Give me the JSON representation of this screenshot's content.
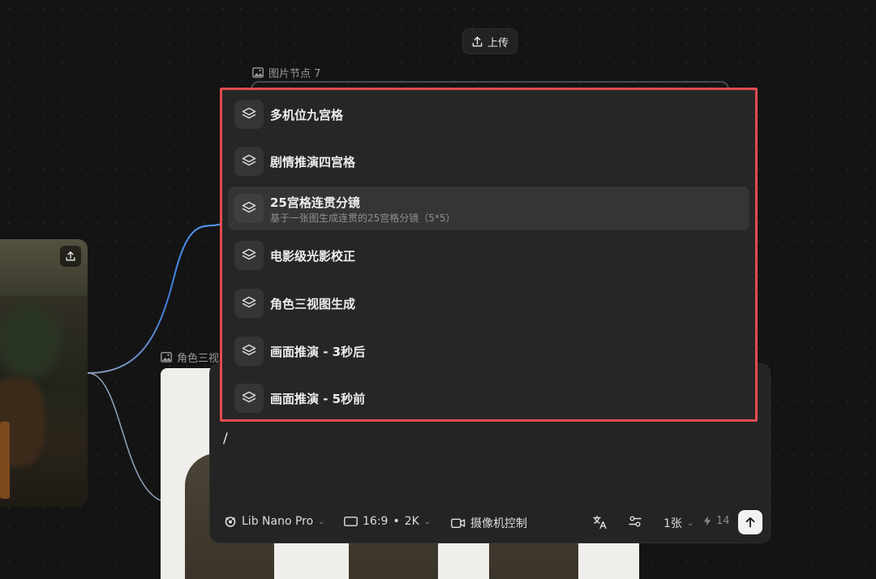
{
  "top_upload": {
    "label": "上传",
    "icon": "upload-icon"
  },
  "node_7": {
    "label": "图片节点 7",
    "icon": "image-icon"
  },
  "node_3v": {
    "label": "角色三视",
    "icon": "image-icon"
  },
  "menu": {
    "items": [
      {
        "title": "多机位九宫格",
        "desc": "",
        "icon": "layers-icon"
      },
      {
        "title": "剧情推演四宫格",
        "desc": "",
        "icon": "layers-icon"
      },
      {
        "title": "25宫格连贯分镜",
        "desc": "基于一张图生成连贯的25宫格分镜（5*5）",
        "icon": "layers-icon",
        "active": true
      },
      {
        "title": "电影级光影校正",
        "desc": "",
        "icon": "layers-icon"
      },
      {
        "title": "角色三视图生成",
        "desc": "",
        "icon": "layers-icon"
      },
      {
        "title": "画面推演 - 3秒后",
        "desc": "",
        "icon": "layers-icon"
      },
      {
        "title": "画面推演 - 5秒前",
        "desc": "",
        "icon": "layers-icon"
      }
    ]
  },
  "prompt": {
    "value": "/",
    "model": "Lib Nano Pro",
    "aspect": "16:9",
    "dot": "•",
    "resolution": "2K",
    "camera": "摄像机控制",
    "count": "1张",
    "credits": "14"
  },
  "colors": {
    "highlight_border": "#e34b4f",
    "background": "#141414",
    "panel": "#242424"
  }
}
